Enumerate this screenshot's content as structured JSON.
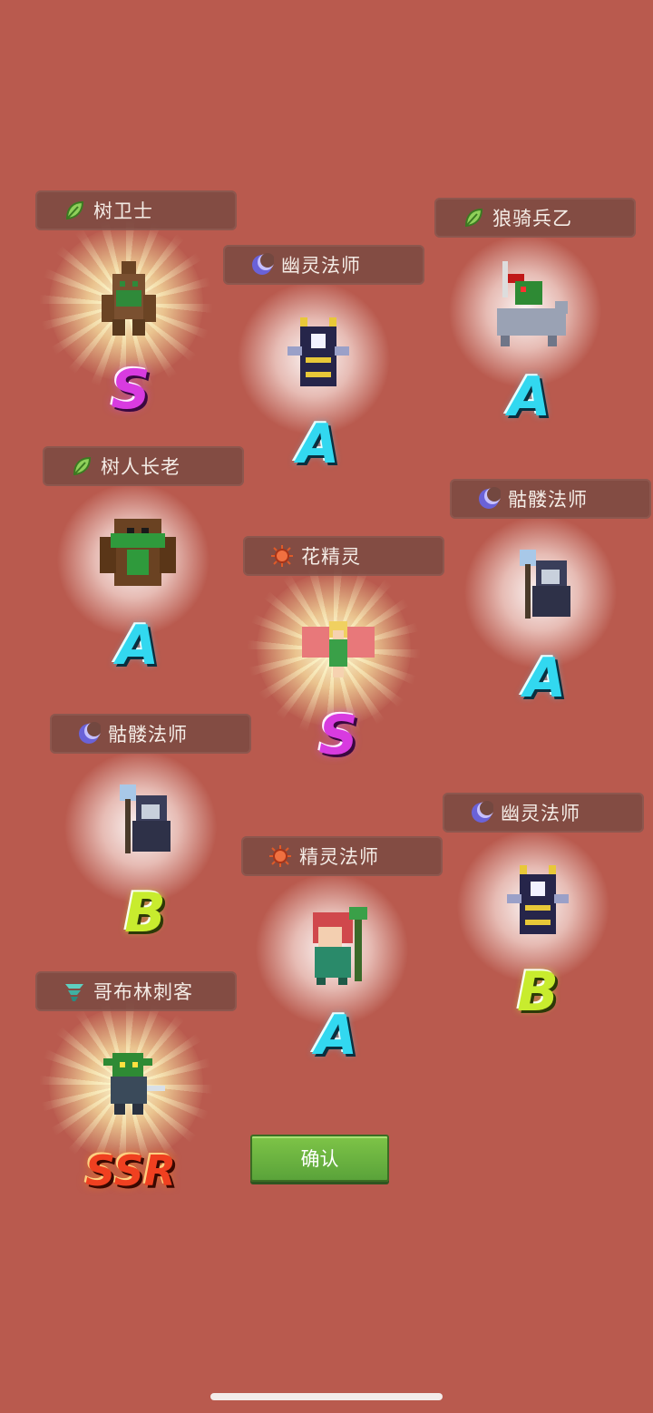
{
  "units": [
    {
      "name": "树卫士",
      "element": "leaf-icon",
      "rank": "S"
    },
    {
      "name": "幽灵法师",
      "element": "moon-icon",
      "rank": "A"
    },
    {
      "name": "狼骑兵乙",
      "element": "leaf-icon",
      "rank": "A"
    },
    {
      "name": "树人长老",
      "element": "leaf-icon",
      "rank": "A"
    },
    {
      "name": "骷髅法师",
      "element": "moon-icon",
      "rank": "A"
    },
    {
      "name": "花精灵",
      "element": "sun-icon",
      "rank": "S"
    },
    {
      "name": "骷髅法师",
      "element": "moon-icon",
      "rank": "B"
    },
    {
      "name": "幽灵法师",
      "element": "moon-icon",
      "rank": "B"
    },
    {
      "name": "精灵法师",
      "element": "sun-icon",
      "rank": "A"
    },
    {
      "name": "哥布林刺客",
      "element": "wind-icon",
      "rank": "SSR"
    }
  ],
  "confirm_label": "确认",
  "colors": {
    "background": "#b95a4e",
    "confirm_button": "#6db840"
  }
}
